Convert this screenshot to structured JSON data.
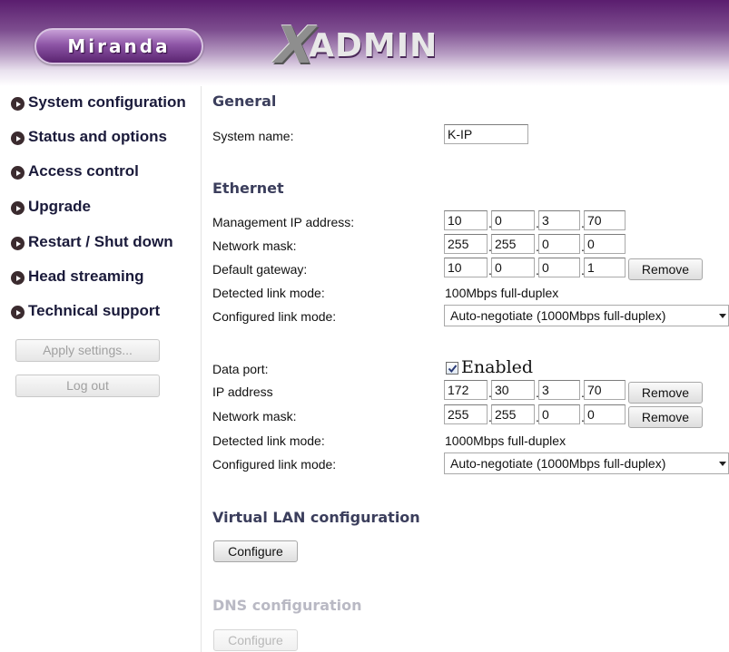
{
  "header": {
    "brand": "Miranda",
    "product_x": "X",
    "product_rest": "ADMIN"
  },
  "sidebar": {
    "items": [
      {
        "label": "System configuration"
      },
      {
        "label": "Status and options"
      },
      {
        "label": "Access control"
      },
      {
        "label": "Upgrade"
      },
      {
        "label": "Restart / Shut down"
      },
      {
        "label": "Head streaming"
      },
      {
        "label": "Technical support"
      }
    ],
    "apply_label": "Apply settings...",
    "logout_label": "Log out"
  },
  "general": {
    "title": "General",
    "system_name_label": "System name:",
    "system_name_value": "K-IP"
  },
  "ethernet": {
    "title": "Ethernet",
    "mgmt_ip_label": "Management IP address:",
    "mgmt_ip": [
      "10",
      "0",
      "3",
      "70"
    ],
    "netmask_label": "Network mask:",
    "netmask": [
      "255",
      "255",
      "0",
      "0"
    ],
    "gateway_label": "Default gateway:",
    "gateway": [
      "10",
      "0",
      "0",
      "1"
    ],
    "remove_label": "Remove",
    "detected_label": "Detected link mode:",
    "detected_value": "100Mbps full-duplex",
    "configured_label": "Configured link mode:",
    "configured_value": "Auto-negotiate (1000Mbps full-duplex)"
  },
  "dataport": {
    "label": "Data port:",
    "enabled_label": "Enabled",
    "enabled_checked": true,
    "ip_label": "IP address",
    "ip": [
      "172",
      "30",
      "3",
      "70"
    ],
    "netmask_label": "Network mask:",
    "netmask": [
      "255",
      "255",
      "0",
      "0"
    ],
    "remove_label": "Remove",
    "detected_label": "Detected link mode:",
    "detected_value": "1000Mbps full-duplex",
    "configured_label": "Configured link mode:",
    "configured_value": "Auto-negotiate (1000Mbps full-duplex)"
  },
  "vlan": {
    "title": "Virtual LAN configuration",
    "configure_label": "Configure"
  },
  "dns": {
    "title": "DNS configuration",
    "configure_label": "Configure"
  }
}
